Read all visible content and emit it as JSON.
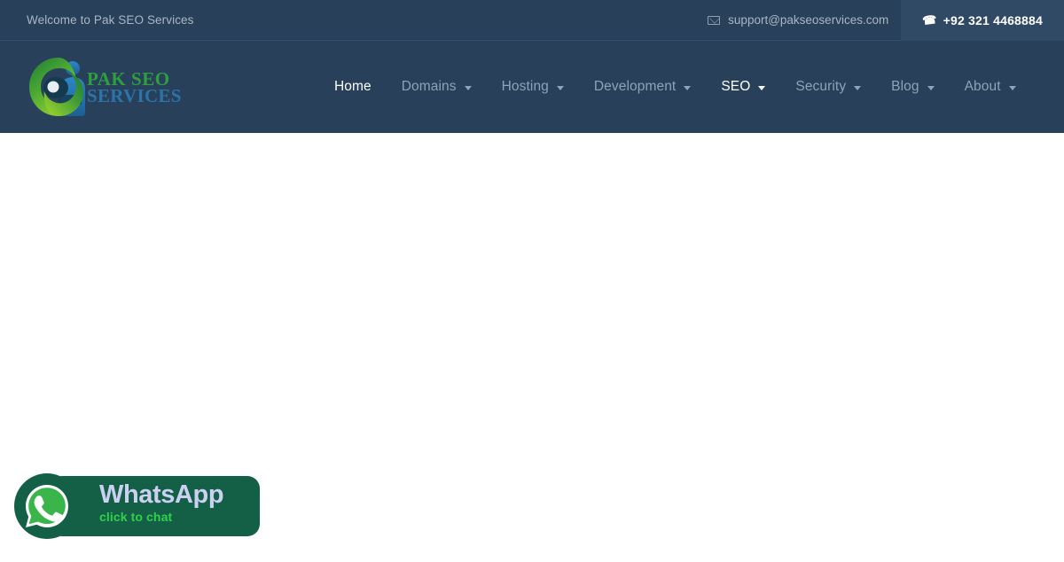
{
  "topbar": {
    "welcome_text": "Welcome to Pak SEO Services",
    "email_icon": "envelope-icon",
    "email": "support@pakseoservices.com",
    "phone_icon": "phone-icon",
    "phone": "+92 321 4468884",
    "background_color": "#28405a",
    "phone_button_color": "#304964"
  },
  "header": {
    "background_color": "#28405a",
    "logo": {
      "icon": "pak-seo-swirl-logo",
      "line1": "PAK SEO",
      "line2": "SERVICES",
      "line1_color": "#2f9e41",
      "line2_color": "#2a74ab"
    },
    "nav": [
      {
        "label": "Home",
        "has_dropdown": false,
        "active": true
      },
      {
        "label": "Domains",
        "has_dropdown": true,
        "active": false
      },
      {
        "label": "Hosting",
        "has_dropdown": true,
        "active": false
      },
      {
        "label": "Development",
        "has_dropdown": true,
        "active": false
      },
      {
        "label": "SEO",
        "has_dropdown": true,
        "active": true
      },
      {
        "label": "Security",
        "has_dropdown": true,
        "active": false
      },
      {
        "label": "Blog",
        "has_dropdown": true,
        "active": false
      },
      {
        "label": "About",
        "has_dropdown": true,
        "active": false
      }
    ]
  },
  "content": {
    "background_color": "#ffffff"
  },
  "whatsapp_widget": {
    "icon": "whatsapp-icon",
    "title": "WhatsApp",
    "subtitle": "click to chat",
    "pill_color": "#146046",
    "title_color": "#ccd0f2",
    "subtitle_color": "#2fd14a"
  }
}
